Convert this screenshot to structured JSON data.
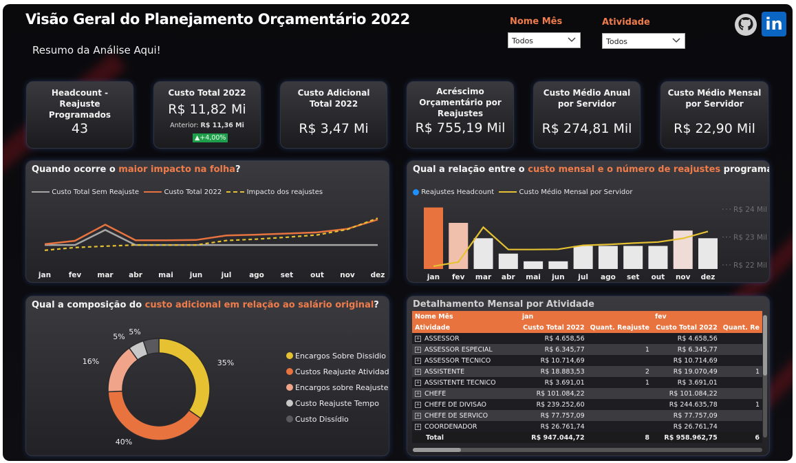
{
  "header": {
    "title": "Visão Geral do Planejamento Orçamentário 2022",
    "subtitle": "Resumo da Análise Aqui!"
  },
  "slicers": {
    "month": {
      "label": "Nome Mês",
      "value": "Todos"
    },
    "activity": {
      "label": "Atividade",
      "value": "Todos"
    }
  },
  "social": {
    "github": "github-icon",
    "linkedin": "linkedin-icon",
    "linkedin_text": "in"
  },
  "kpis": {
    "headcount": {
      "title": "Headcount - Reajuste Programados",
      "value": "43"
    },
    "total": {
      "title": "Custo Total 2022",
      "value": "R$ 11,82 Mi",
      "previous_label": "Anterior:",
      "previous_value": "R$ 11,36 Mi",
      "delta": "▲+4,00%"
    },
    "additional": {
      "title": "Custo Adicional Total 2022",
      "value": "R$ 3,47 Mi"
    },
    "increase": {
      "title": "Acréscimo Orçamentário por Reajustes",
      "value": "R$ 755,19 Mil"
    },
    "avg_annual": {
      "title": "Custo Médio Anual por Servidor",
      "value": "R$ 274,81 Mil"
    },
    "avg_monthly": {
      "title": "Custo Médio Mensal por Servidor",
      "value": "R$ 22,90 Mil"
    }
  },
  "line_chart": {
    "title_pre": "Quando ocorre o ",
    "title_hl": "maior impacto na folha",
    "title_post": "?",
    "series_names": [
      "Custo Total Sem Reajuste",
      "Custo Total 2022",
      "Impacto dos reajustes"
    ],
    "colors": [
      "#a6a6a6",
      "#e8733f",
      "#e6c232"
    ]
  },
  "combo_chart": {
    "title_pre": "Qual a relação entre o ",
    "title_hl": "custo mensal e o número de reajustes",
    "title_post": " programados?",
    "series_names": [
      "Reajustes Headcount",
      "Custo Médio Mensal por Servidor"
    ],
    "colors": [
      "#1e90ff",
      "#e6c232"
    ]
  },
  "donut_chart": {
    "title_pre": "Qual a composição do ",
    "title_hl": "custo adicional em relação ao salário original",
    "title_post": "?"
  },
  "matrix": {
    "title": "Detalhamento Mensal por Atividade",
    "row_header_1": "Nome Mês",
    "row_header_2": "Atividade",
    "months": [
      "jan",
      "fev"
    ],
    "col_cost": "Custo Total 2022",
    "col_qty": "Quant. Reajuste",
    "col_qty_cut": "Quant. Re",
    "rows": [
      {
        "name": "ASSESSOR",
        "jan_cost": "R$ 4.658,56",
        "jan_qty": "",
        "fev_cost": "R$ 4.658,56",
        "fev_qty": ""
      },
      {
        "name": "ASSESSOR ESPECIAL",
        "jan_cost": "R$ 6.345,77",
        "jan_qty": "1",
        "fev_cost": "R$ 6.345,77",
        "fev_qty": ""
      },
      {
        "name": "ASSESSOR TECNICO",
        "jan_cost": "R$ 10.714,69",
        "jan_qty": "",
        "fev_cost": "R$ 10.714,69",
        "fev_qty": ""
      },
      {
        "name": "ASSISTENTE",
        "jan_cost": "R$ 18.883,53",
        "jan_qty": "2",
        "fev_cost": "R$ 19.070,49",
        "fev_qty": "1"
      },
      {
        "name": "ASSISTENTE TECNICO",
        "jan_cost": "R$ 3.691,01",
        "jan_qty": "1",
        "fev_cost": "R$ 3.691,01",
        "fev_qty": ""
      },
      {
        "name": "CHEFE",
        "jan_cost": "R$ 101.084,22",
        "jan_qty": "",
        "fev_cost": "R$ 101.084,22",
        "fev_qty": ""
      },
      {
        "name": "CHEFE DE DIVISAO",
        "jan_cost": "R$ 239.252,60",
        "jan_qty": "",
        "fev_cost": "R$ 244.635,78",
        "fev_qty": "1"
      },
      {
        "name": "CHEFE DE SERVICO",
        "jan_cost": "R$ 77.757,09",
        "jan_qty": "",
        "fev_cost": "R$ 77.757,09",
        "fev_qty": ""
      },
      {
        "name": "COORDENADOR",
        "jan_cost": "R$ 26.761,74",
        "jan_qty": "",
        "fev_cost": "R$ 26.761,74",
        "fev_qty": ""
      }
    ],
    "total": {
      "label": "Total",
      "jan_cost": "R$ 947.044,72",
      "jan_qty": "8",
      "fev_cost": "R$ 958.962,75",
      "fev_qty": "6"
    }
  },
  "chart_data": [
    {
      "type": "line",
      "title": "Quando ocorre o maior impacto na folha?",
      "x": [
        "jan",
        "fev",
        "mar",
        "abr",
        "mai",
        "jun",
        "jul",
        "ago",
        "set",
        "out",
        "nov",
        "dez"
      ],
      "series": [
        {
          "name": "Custo Total Sem Reajuste",
          "values": [
            0.944,
            0.944,
            0.998,
            0.944,
            0.944,
            0.944,
            0.944,
            0.944,
            0.944,
            0.944,
            0.944,
            0.944
          ]
        },
        {
          "name": "Custo Total 2022",
          "values": [
            0.947,
            0.959,
            1.017,
            0.961,
            0.961,
            0.962,
            0.978,
            0.981,
            0.985,
            0.989,
            1.002,
            1.035
          ]
        },
        {
          "name": "Impacto dos reajustes",
          "values": [
            0.925,
            0.935,
            0.94,
            0.944,
            0.944,
            0.944,
            0.96,
            0.965,
            0.972,
            0.98,
            1.0,
            1.04
          ]
        }
      ],
      "ylim": [
        0.9,
        1.06
      ]
    },
    {
      "type": "bar",
      "title": "Qual a relação entre o custo mensal e o número de reajustes programados?",
      "categories": [
        "jan",
        "fev",
        "mar",
        "abr",
        "mai",
        "jun",
        "jul",
        "ago",
        "set",
        "out",
        "nov",
        "dez"
      ],
      "series": [
        {
          "name": "Reajustes Headcount",
          "values": [
            8,
            6,
            4,
            2,
            1,
            1,
            3,
            3,
            3,
            3,
            5,
            4
          ]
        },
        {
          "name": "Custo Médio Mensal por Servidor",
          "values": [
            21.95,
            22.1,
            23.35,
            22.55,
            22.55,
            22.56,
            22.7,
            22.73,
            22.78,
            22.82,
            22.95,
            23.2
          ]
        }
      ],
      "y2_ticks": [
        "R$ 24 Mil",
        "R$ 23 Mil",
        "R$ 22 Mil"
      ],
      "y2lim": [
        21.9,
        24.0
      ],
      "ylim": [
        0,
        8.5
      ],
      "bar_colors": [
        "#e8733f",
        "#f0c0ad",
        "#e8e8e8",
        "#e8e8e8",
        "#e8e8e8",
        "#e8e8e8",
        "#e8e8e8",
        "#e8e8e8",
        "#e8e8e8",
        "#e8e8e8",
        "#efdcd6",
        "#e8e8e8"
      ]
    },
    {
      "type": "pie",
      "title": "Qual a composição do custo adicional em relação ao salário original?",
      "labels": [
        "Encargos Sobre Dissidio",
        "Custos Reajuste Atividade",
        "Encargos sobre Reajuste",
        "Custo Reajuste Tempo",
        "Custo Dissídio"
      ],
      "values": [
        35,
        40,
        16,
        5,
        5
      ],
      "value_labels": [
        "35%",
        "40%",
        "16%",
        "5%",
        "5%"
      ],
      "colors": [
        "#e6c232",
        "#e8733f",
        "#f0a58a",
        "#c8c8c8",
        "#5a5a5e"
      ]
    }
  ]
}
